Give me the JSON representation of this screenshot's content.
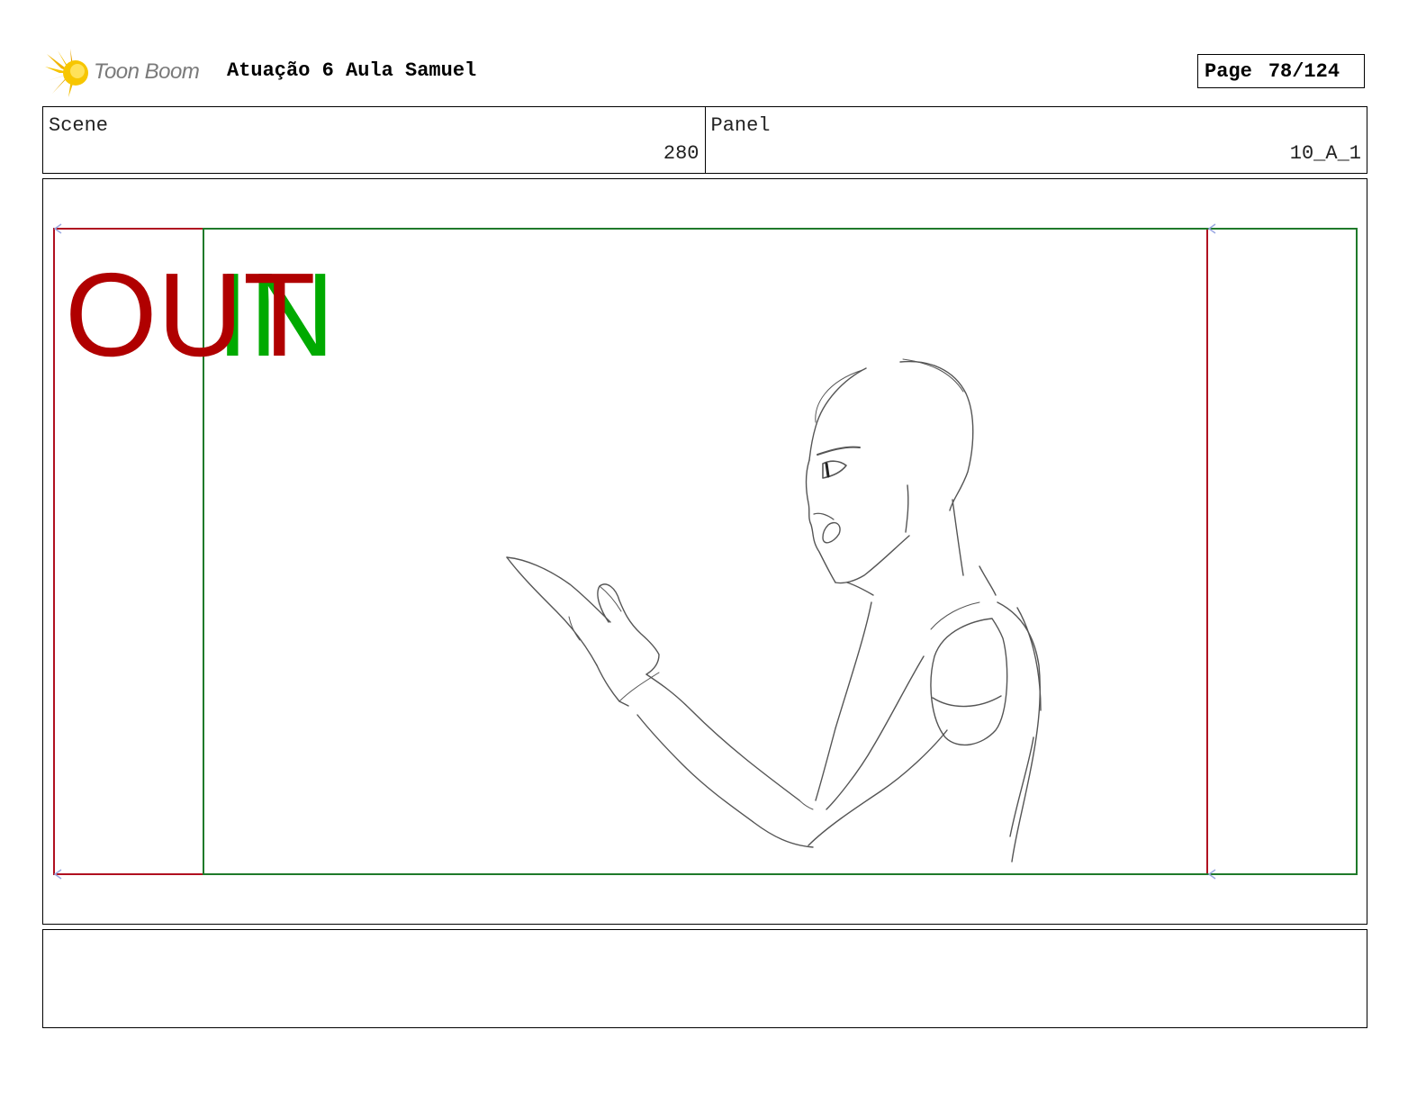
{
  "header": {
    "logo_text": "Toon Boom",
    "project_title": "Atuação 6 Aula Samuel",
    "page_label": "Page",
    "page_number": "78/124"
  },
  "scene": {
    "label": "Scene",
    "value": "280"
  },
  "panel": {
    "label": "Panel",
    "value": "10_A_1"
  },
  "frame_marks": {
    "out_label": "OUT",
    "out_color": "#b00000",
    "in_label": "IN",
    "in_color": "#00aa00"
  },
  "notes": {
    "text": ""
  }
}
